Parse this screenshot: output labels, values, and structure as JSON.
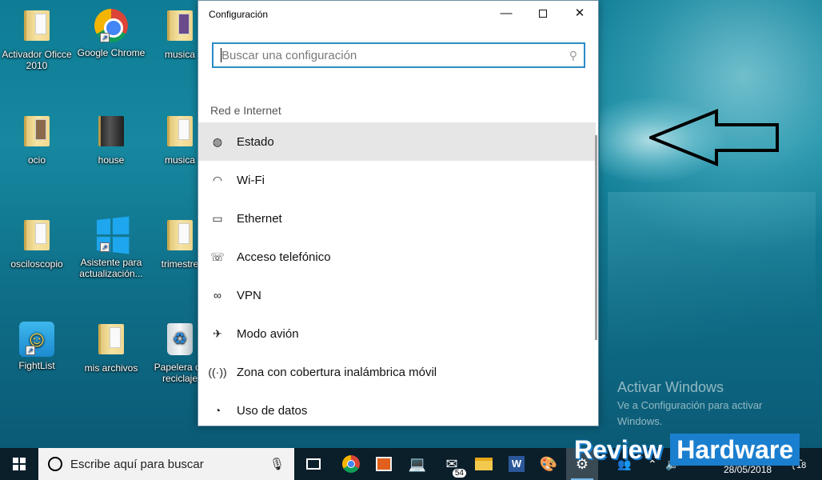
{
  "desktop": {
    "icons": [
      {
        "label": "Activador Oficce 2010",
        "icon": "folder-icon"
      },
      {
        "label": "Google Chrome",
        "icon": "chrome-icon"
      },
      {
        "label": "musica",
        "icon": "folder-icon"
      },
      {
        "label": "ocio",
        "icon": "folder-icon"
      },
      {
        "label": "house",
        "icon": "folder-icon"
      },
      {
        "label": "musica",
        "icon": "folder-icon"
      },
      {
        "label": "osciloscopio",
        "icon": "folder-icon"
      },
      {
        "label": "Asistente para actualización...",
        "icon": "windows-update-icon"
      },
      {
        "label": "trimestre",
        "icon": "folder-icon"
      },
      {
        "label": "FightList",
        "icon": "lightbulb-icon"
      },
      {
        "label": "mis archivos",
        "icon": "folder-icon"
      },
      {
        "label": "Papelera de reciclaje",
        "icon": "recycle-bin-icon"
      }
    ]
  },
  "window": {
    "title": "Configuración",
    "controls": {
      "minimize": "—",
      "close": "✕"
    },
    "search": {
      "placeholder": "Buscar una configuración",
      "icon": "search-icon"
    },
    "section": "Red e Internet",
    "nav": [
      {
        "label": "Estado",
        "icon": "globe-icon",
        "active": true
      },
      {
        "label": "Wi-Fi",
        "icon": "wifi-icon",
        "active": false
      },
      {
        "label": "Ethernet",
        "icon": "ethernet-icon",
        "active": false
      },
      {
        "label": "Acceso telefónico",
        "icon": "dial-up-icon",
        "active": false
      },
      {
        "label": "VPN",
        "icon": "vpn-icon",
        "active": false
      },
      {
        "label": "Modo avión",
        "icon": "airplane-icon",
        "active": false
      },
      {
        "label": "Zona con cobertura inalámbrica móvil",
        "icon": "hotspot-icon",
        "active": false
      },
      {
        "label": "Uso de datos",
        "icon": "data-usage-icon",
        "active": false
      }
    ]
  },
  "watermark": {
    "heading": "Activar Windows",
    "sub": "Ve a Configuración para activar Windows."
  },
  "logo": {
    "part1": "Review",
    "part2": "Hardware"
  },
  "taskbar": {
    "search_text": "Escribe aquí para buscar",
    "mail_badge": "54",
    "date": "28/05/2018",
    "notification_count": "18"
  },
  "colors": {
    "accent": "#2b8bc6",
    "taskbar": "#0b1f2b",
    "active_item": "#e6e6e6"
  }
}
